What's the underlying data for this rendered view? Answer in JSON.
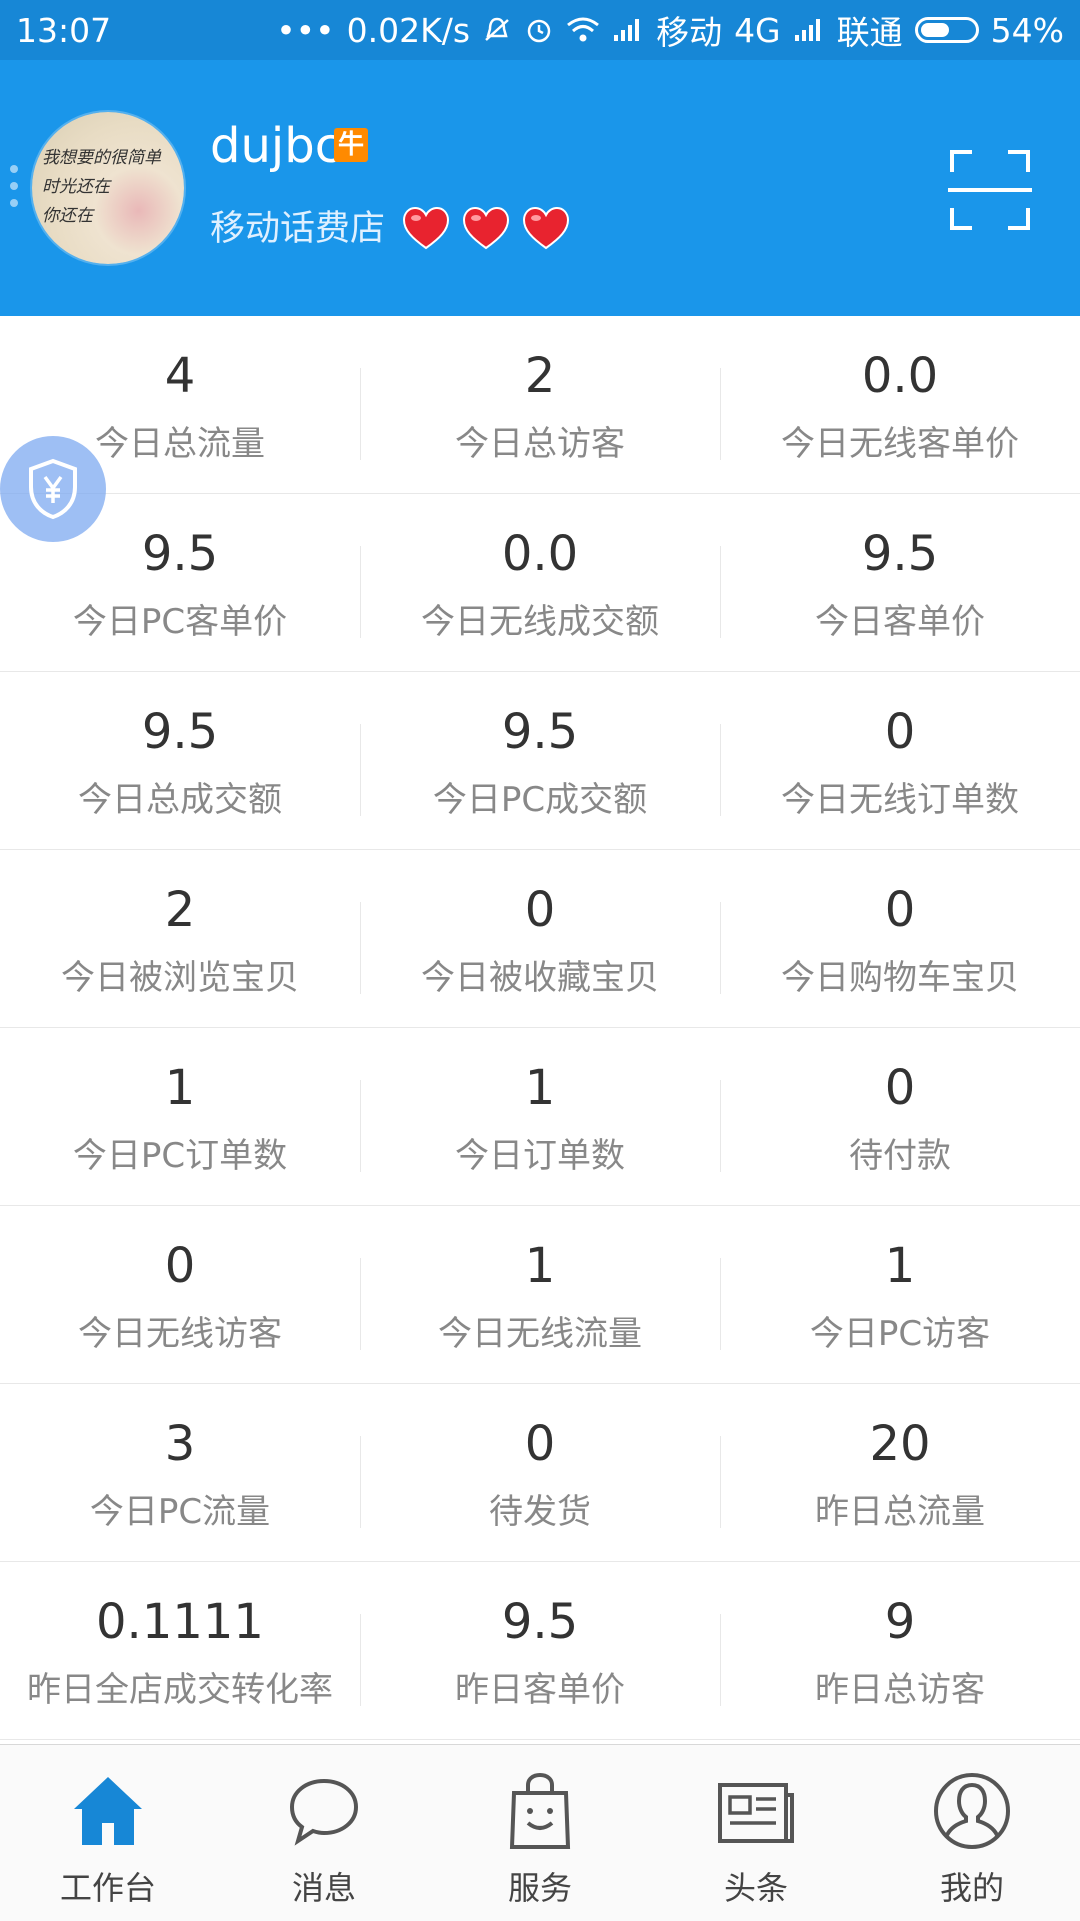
{
  "status_bar": {
    "time": "13:07",
    "dots": "•••",
    "net_speed": "0.02K/s",
    "carrier1": "移动",
    "network1": "4G",
    "carrier2": "联通",
    "battery": "54%",
    "battery_level": 0.54
  },
  "header": {
    "avatar_text": "我想要的很简单\n时光还在\n你还在",
    "username": "dujbc",
    "badge": "牛",
    "shop_name": "移动话费店",
    "hearts": 3,
    "accent": "#1a96ea"
  },
  "stats": [
    [
      {
        "value": "4",
        "label": "今日总流量"
      },
      {
        "value": "2",
        "label": "今日总访客"
      },
      {
        "value": "0.0",
        "label": "今日无线客单价"
      }
    ],
    [
      {
        "value": "9.5",
        "label": "今日PC客单价"
      },
      {
        "value": "0.0",
        "label": "今日无线成交额"
      },
      {
        "value": "9.5",
        "label": "今日客单价"
      }
    ],
    [
      {
        "value": "9.5",
        "label": "今日总成交额"
      },
      {
        "value": "9.5",
        "label": "今日PC成交额"
      },
      {
        "value": "0",
        "label": "今日无线订单数"
      }
    ],
    [
      {
        "value": "2",
        "label": "今日被浏览宝贝"
      },
      {
        "value": "0",
        "label": "今日被收藏宝贝"
      },
      {
        "value": "0",
        "label": "今日购物车宝贝"
      }
    ],
    [
      {
        "value": "1",
        "label": "今日PC订单数"
      },
      {
        "value": "1",
        "label": "今日订单数"
      },
      {
        "value": "0",
        "label": "待付款"
      }
    ],
    [
      {
        "value": "0",
        "label": "今日无线访客"
      },
      {
        "value": "1",
        "label": "今日无线流量"
      },
      {
        "value": "1",
        "label": "今日PC访客"
      }
    ],
    [
      {
        "value": "3",
        "label": "今日PC流量"
      },
      {
        "value": "0",
        "label": "待发货"
      },
      {
        "value": "20",
        "label": "昨日总流量"
      }
    ],
    [
      {
        "value": "0.1111",
        "label": "昨日全店成交转化率"
      },
      {
        "value": "9.5",
        "label": "昨日客单价"
      },
      {
        "value": "9",
        "label": "昨日总访客"
      }
    ]
  ],
  "bottom_nav": [
    {
      "label": "工作台",
      "icon": "home-icon",
      "active": true
    },
    {
      "label": "消息",
      "icon": "chat-bubble-icon",
      "active": false
    },
    {
      "label": "服务",
      "icon": "shopping-bag-icon",
      "active": false
    },
    {
      "label": "头条",
      "icon": "newspaper-icon",
      "active": false
    },
    {
      "label": "我的",
      "icon": "user-icon",
      "active": false
    }
  ],
  "colors": {
    "active": "#1787d6",
    "inactive": "#444444",
    "value": "#333333",
    "label": "#888888"
  }
}
